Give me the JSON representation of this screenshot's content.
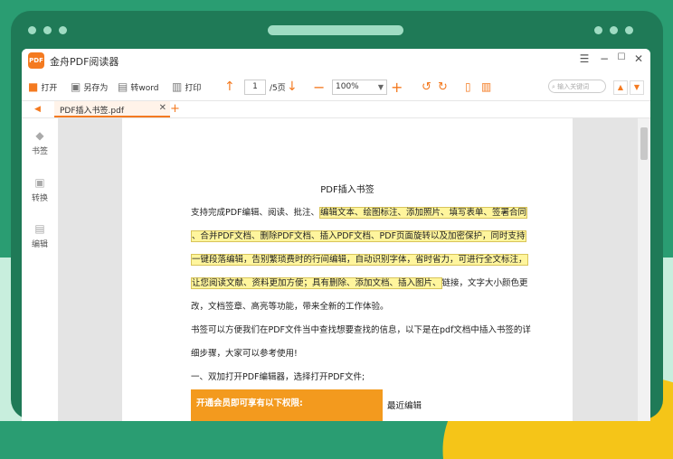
{
  "app": {
    "title": "金舟PDF阅读器",
    "logo_text": "PDF"
  },
  "toolbar": {
    "open_label": "打开",
    "save_as_label": "另存为",
    "to_word_label": "转word",
    "print_label": "打印",
    "page_current": "1",
    "page_total": "/5页",
    "zoom": "100%",
    "search_placeholder": "输入关键词"
  },
  "tab": {
    "filename": "PDF插入书签.pdf"
  },
  "sidebar": {
    "items": [
      {
        "label": "书签"
      },
      {
        "label": "转换"
      },
      {
        "label": "编辑"
      }
    ]
  },
  "document": {
    "title": "PDF插入书签",
    "p1_lead": "支持完成PDF编辑、阅读、批注、",
    "p1_hl": "编辑文本、绘图标注、添加照片、填写表单、签署合同",
    "p2_hl": "、合并PDF文档、删除PDF文档、插入PDF文档、PDF页面旋转以及加密保护，同时支持",
    "p3_hl": "一键段落编辑，告别繁琐费时的行间编辑，自动识别字体，省时省力，可进行全文标注，",
    "p4_hl": "让您阅读文献、资料更加方便；具有删除、添加文档、插入图片、",
    "p4_tail": "链接，文字大小颜色更",
    "p5": "改，文档签章、高亮等功能，带来全新的工作体验。",
    "p6": "书签可以方便我们在PDF文件当中查找想要查找的信息，以下是在pdf文档中插入书签的详",
    "p7": "细步骤，大家可以参考使用!",
    "p8": "一、双加打开PDF编辑器，选择打开PDF文件;",
    "banner": "开通会员即可享有以下权限:",
    "side_label": "最近编辑"
  },
  "colors": {
    "accent": "#f47a20",
    "highlight": "#fff59d",
    "banner": "#f39a1e",
    "frame": "#1f7a57"
  }
}
